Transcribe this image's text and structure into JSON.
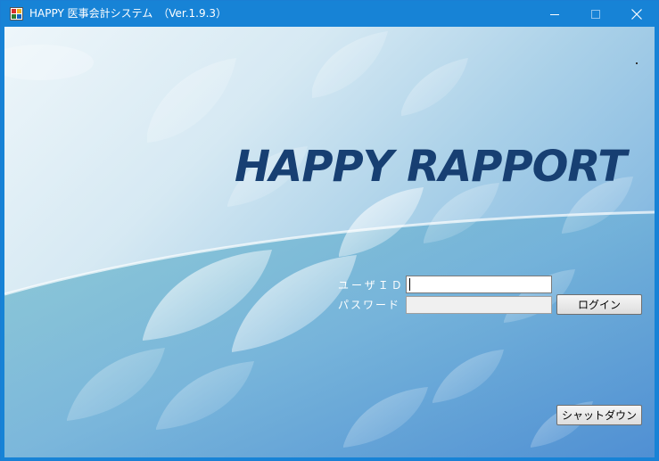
{
  "window": {
    "title": "HAPPY 医事会計システム　（Ver.1.9.3）",
    "accent_color": "#1783d6",
    "controls": {
      "minimize_icon": "minimize-icon",
      "maximize_icon": "maximize-icon",
      "close_icon": "close-icon"
    }
  },
  "brand": {
    "title": "HAPPY RAPPORT",
    "color": "#173f72"
  },
  "login": {
    "user_id_label": "ユーザＩＤ",
    "user_id_value": "",
    "password_label": "パスワード",
    "password_value": "",
    "login_button": "ログイン"
  },
  "footer": {
    "shutdown_button": "シャットダウン"
  }
}
